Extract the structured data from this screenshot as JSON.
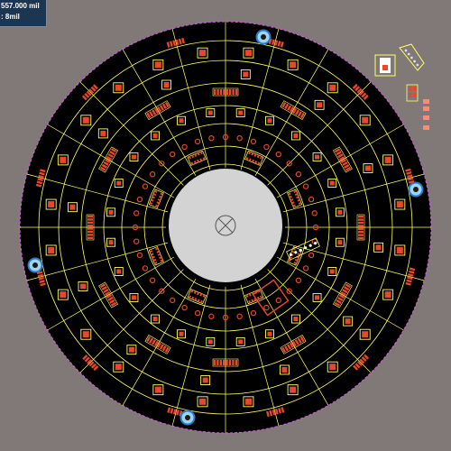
{
  "hud": {
    "coordinate_readout": "557.000 mil",
    "grid_readout": ": 8mil"
  },
  "colors": {
    "workspace": "#817977",
    "board": "#000000",
    "board_outline": "#c85ed0",
    "center_cutout": "#d3d3d3",
    "silkscreen": "#ffff66",
    "pad_copper": "#e8472c",
    "pad_highlight": "#ff8a70",
    "mounting_hole_ring": "#2a7ac8",
    "mounting_hole_fill": "#9ed4f0",
    "hud_background": "#1c3550"
  },
  "board": {
    "shape": "circular",
    "center_cutout": "fiducial-crosshair-icon",
    "mounting_holes": 4
  }
}
